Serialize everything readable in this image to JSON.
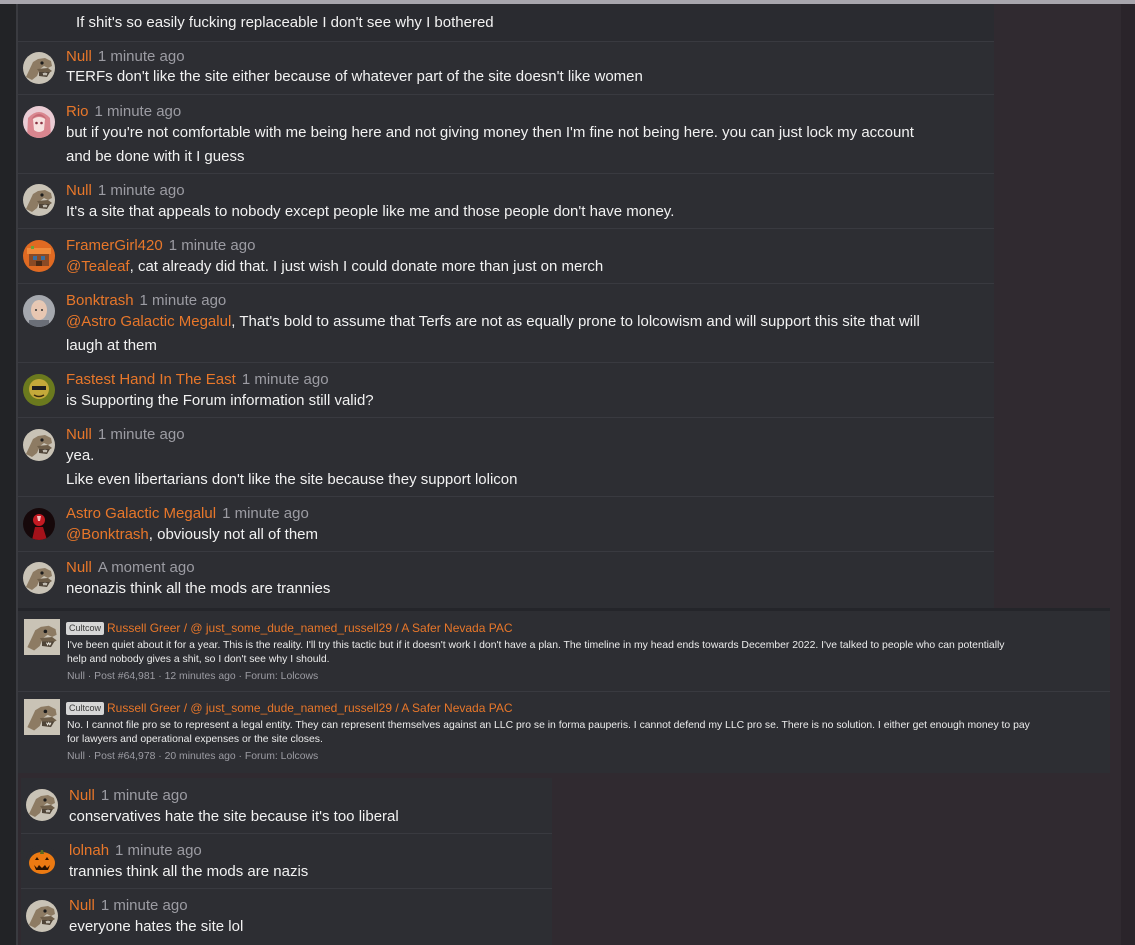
{
  "top_fragment": {
    "text": "If shit's so easily fucking replaceable I don't see why I bothered"
  },
  "messages": [
    {
      "author": "Null",
      "time": "1 minute ago",
      "text": "TERFs don't like the site either because of whatever part of the site doesn't like women"
    },
    {
      "author": "Rio",
      "time": "1 minute ago",
      "line1": "but if you're not comfortable with me being here and not giving money then I'm fine not being here. you can just lock my account",
      "line2": "and be done with it I guess"
    },
    {
      "author": "Null",
      "time": "1 minute ago",
      "text": "It's a site that appeals to nobody except people like me and those people don't have money."
    },
    {
      "author": "FramerGirl420",
      "time": "1 minute ago",
      "mention": "@Tealeaf",
      "text": ", cat already did that. I just wish I could donate more than just on merch"
    },
    {
      "author": "Bonktrash",
      "time": "1 minute ago",
      "mention": "@Astro Galactic Megalul",
      "line1": ", That's bold to assume that Terfs are not as equally prone to lolcowism and will support this site that will",
      "line2": "laugh at them"
    },
    {
      "author": "Fastest Hand In The East",
      "time": "1 minute ago",
      "text": "is Supporting the Forum information still valid?"
    },
    {
      "author": "Null",
      "time": "1 minute ago",
      "line1": "yea.",
      "line2": "Like even libertarians don't like the site because they support lolicon"
    },
    {
      "author": "Astro Galactic Megalul",
      "time": "1 minute ago",
      "mention": "@Bonktrash",
      "text": ", obviously not all of them"
    },
    {
      "author": "Null",
      "time": "A moment ago",
      "text": "neonazis think all the mods are trannies"
    }
  ],
  "quotes": [
    {
      "badge": "Cultcow",
      "title": "Russell Greer / @ just_some_dude_named_russell29 / A Safer Nevada PAC",
      "line1": "I've been quiet about it for a year. This is the reality. I'll try this tactic but if it doesn't work I don't have a plan. The timeline in my head ends towards December 2022. I've talked to people who can potentially",
      "line2": "help and nobody gives a shit, so I don't see why I should.",
      "meta": "Null · Post #64,981 · 12 minutes ago · Forum: Lolcows"
    },
    {
      "badge": "Cultcow",
      "title": "Russell Greer / @ just_some_dude_named_russell29 / A Safer Nevada PAC",
      "line1": "No. I cannot file pro se to represent a legal entity. They can represent themselves against an LLC pro se in forma pauperis. I cannot defend my LLC pro se. There is no solution. I either get enough money to pay",
      "line2": "for lawyers and operational expenses or the site closes.",
      "meta": "Null · Post #64,978 · 20 minutes ago · Forum: Lolcows"
    }
  ],
  "messages_bottom": [
    {
      "author": "Null",
      "time": "1 minute ago",
      "text": "conservatives hate the site because it's too liberal"
    },
    {
      "author": "lolnah",
      "time": "1 minute ago",
      "text": "trannies think all the mods are nazis"
    },
    {
      "author": "Null",
      "time": "1 minute ago",
      "text": "everyone hates the site lol"
    }
  ],
  "colors": {
    "author": "#e8772a",
    "timestamp": "#9c9ca3",
    "panel": "#2d2e33",
    "page": "#302a30"
  },
  "icons": {
    "null": "dragon-avatar-icon",
    "rio": "anime-girl-avatar-icon",
    "framergirl": "pixel-art-avatar-icon",
    "bonktrash": "face-avatar-icon",
    "fastest": "green-face-avatar-icon",
    "astro": "red-figure-avatar-icon",
    "lolnah": "pumpkin-avatar-icon"
  }
}
